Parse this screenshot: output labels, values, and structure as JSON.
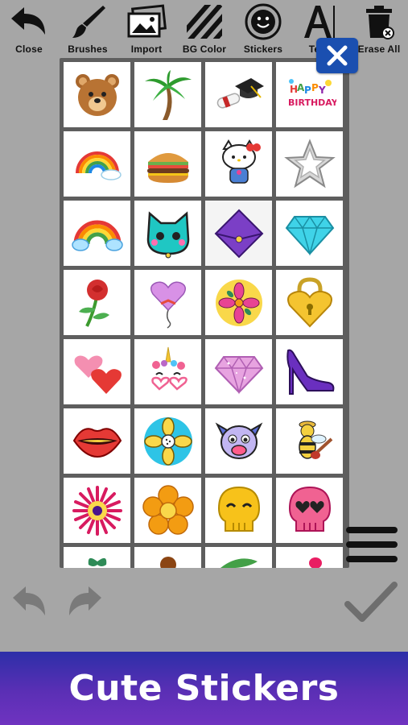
{
  "toolbar": {
    "close": "Close",
    "brushes": "Brushes",
    "import": "Import",
    "bg_color": "BG Color",
    "stickers": "Stickers",
    "text": "Text",
    "erase_all": "Erase All"
  },
  "stickers": [
    {
      "name": "teddy-bear-sticker"
    },
    {
      "name": "palm-tree-sticker"
    },
    {
      "name": "graduation-cap-sticker"
    },
    {
      "name": "happy-birthday-sticker"
    },
    {
      "name": "rainbow-cloud-sticker"
    },
    {
      "name": "burger-sticker"
    },
    {
      "name": "hello-kitty-sticker"
    },
    {
      "name": "silver-star-sticker"
    },
    {
      "name": "rainbow-sticker"
    },
    {
      "name": "cat-face-sticker"
    },
    {
      "name": "envelope-sticker"
    },
    {
      "name": "diamond-sticker"
    },
    {
      "name": "rose-sticker"
    },
    {
      "name": "heart-balloon-sticker"
    },
    {
      "name": "flower-badge-sticker"
    },
    {
      "name": "heart-lock-sticker"
    },
    {
      "name": "hearts-sticker"
    },
    {
      "name": "unicorn-sticker"
    },
    {
      "name": "pink-gem-sticker"
    },
    {
      "name": "high-heel-sticker"
    },
    {
      "name": "lips-sticker"
    },
    {
      "name": "flower-circle-sticker"
    },
    {
      "name": "dog-face-sticker"
    },
    {
      "name": "bee-guitar-sticker"
    },
    {
      "name": "pink-flower-sticker"
    },
    {
      "name": "orange-flower-sticker"
    },
    {
      "name": "yellow-skull-sticker"
    },
    {
      "name": "pink-skull-sticker"
    },
    {
      "name": "leaf-sticker"
    },
    {
      "name": "acorn-sticker"
    },
    {
      "name": "green-leaf-sticker"
    },
    {
      "name": "pink-sticker"
    }
  ],
  "colors": {
    "background": "#a6a6a6",
    "panel": "#5e5e5e",
    "close_accent": "#1a4fb0",
    "banner_top": "#2d2fa8",
    "banner_bottom": "#6f33c0"
  },
  "banner": {
    "text": "Cute Stickers"
  }
}
